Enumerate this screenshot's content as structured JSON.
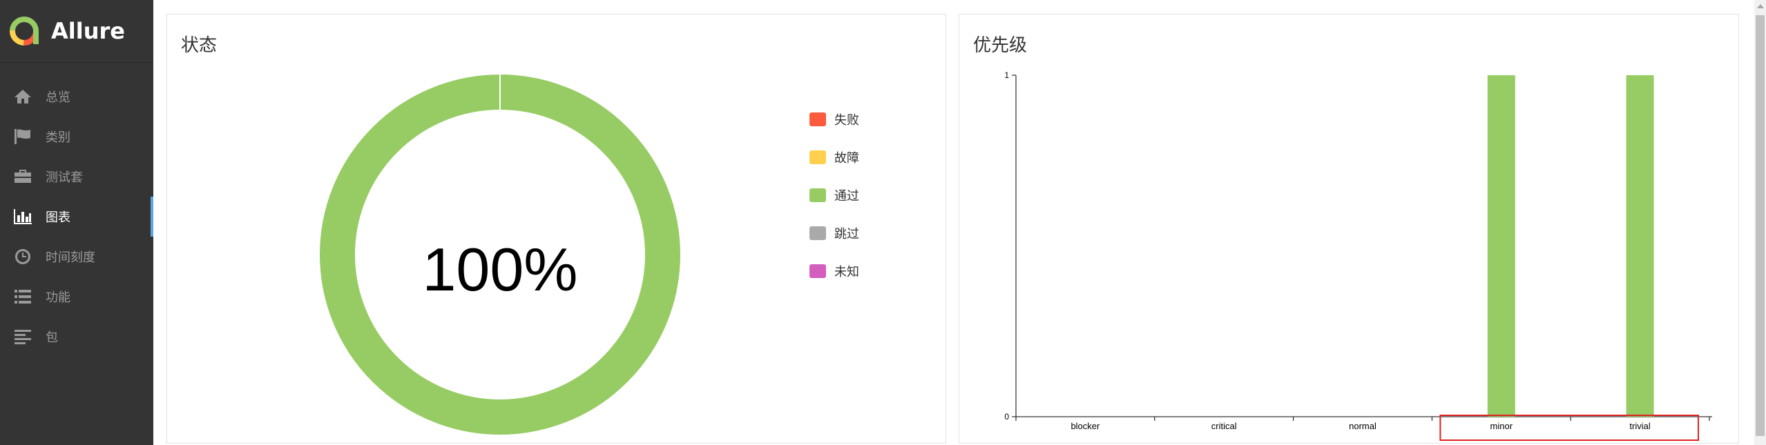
{
  "app": {
    "name": "Allure"
  },
  "sidebar": {
    "items": [
      {
        "label": "总览",
        "icon": "home-icon"
      },
      {
        "label": "类别",
        "icon": "flag-icon"
      },
      {
        "label": "测试套",
        "icon": "briefcase-icon"
      },
      {
        "label": "图表",
        "icon": "bar-chart-icon",
        "active": true
      },
      {
        "label": "时间刻度",
        "icon": "clock-icon"
      },
      {
        "label": "功能",
        "icon": "list-icon"
      },
      {
        "label": "包",
        "icon": "align-left-icon"
      }
    ]
  },
  "status_panel": {
    "title": "状态",
    "center_text": "100%",
    "legend": [
      {
        "label": "失败",
        "color": "#fd5a3e"
      },
      {
        "label": "故障",
        "color": "#ffd050"
      },
      {
        "label": "通过",
        "color": "#97cc64"
      },
      {
        "label": "跳过",
        "color": "#aaaaaa"
      },
      {
        "label": "未知",
        "color": "#d35ebe"
      }
    ]
  },
  "priority_panel": {
    "title": "优先级",
    "highlight_color": "#e02020"
  },
  "chart_data": [
    {
      "type": "pie",
      "categories": [
        "失败",
        "故障",
        "通过",
        "跳过",
        "未知"
      ],
      "values": [
        0,
        0,
        1,
        0,
        0
      ],
      "colors": [
        "#fd5a3e",
        "#ffd050",
        "#97cc64",
        "#aaaaaa",
        "#d35ebe"
      ],
      "title": "状态",
      "donut": true,
      "center_label": "100%",
      "legend_placement": "right"
    },
    {
      "type": "bar",
      "title": "优先级",
      "categories": [
        "blocker",
        "critical",
        "normal",
        "minor",
        "trivial"
      ],
      "values": [
        0,
        0,
        0,
        1,
        1
      ],
      "color": "#97cc64",
      "ylim": [
        0,
        1
      ],
      "yticks": [
        "0",
        "1"
      ],
      "grid": false,
      "xlabel": "",
      "ylabel": ""
    }
  ]
}
